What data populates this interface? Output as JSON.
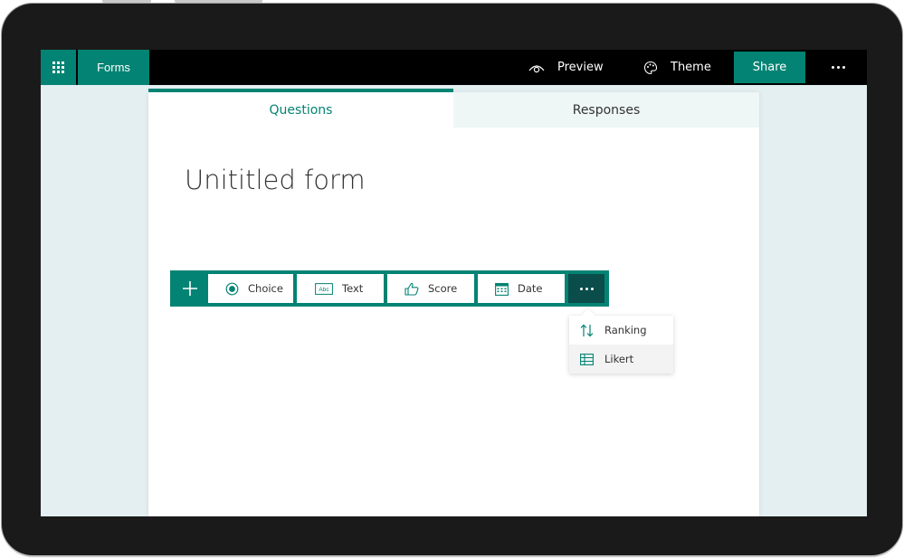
{
  "app": {
    "name": "Forms",
    "app_launcher_icon": "waffle-icon",
    "brand_color": "#038373"
  },
  "topbar": {
    "preview_label": "Preview",
    "preview_icon": "eye-icon",
    "theme_label": "Theme",
    "theme_icon": "palette-icon",
    "share_label": "Share",
    "more_icon": "more-horizontal-icon"
  },
  "tabs": [
    {
      "label": "Questions",
      "active": true
    },
    {
      "label": "Responses",
      "active": false
    }
  ],
  "form": {
    "title": "Unititled form"
  },
  "question_toolbar": {
    "add_icon": "plus-icon",
    "items": [
      {
        "label": "Choice",
        "icon": "radio-icon"
      },
      {
        "label": "Text",
        "icon": "abc-text-icon"
      },
      {
        "label": "Score",
        "icon": "thumbs-up-icon"
      },
      {
        "label": "Date",
        "icon": "calendar-icon"
      }
    ],
    "more_icon": "more-horizontal-icon",
    "more_active_color": "#0b4d4a"
  },
  "more_menu": {
    "items": [
      {
        "label": "Ranking",
        "icon": "sort-arrows-icon",
        "hovered": false
      },
      {
        "label": "Likert",
        "icon": "table-grid-icon",
        "hovered": true
      }
    ]
  }
}
